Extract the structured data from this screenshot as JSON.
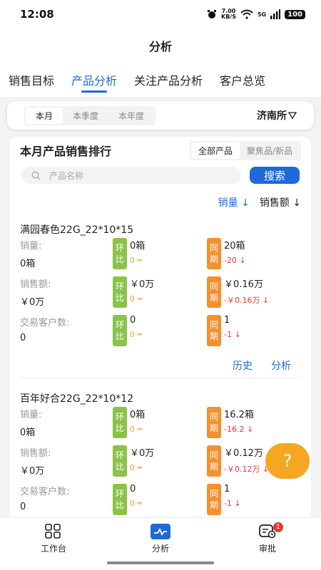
{
  "status": {
    "time": "12:08",
    "speed_value": "7.00",
    "speed_unit": "KB/S",
    "network": "5G",
    "battery": "100"
  },
  "header": {
    "title": "分析"
  },
  "tabs": [
    {
      "label": "销售目标"
    },
    {
      "label": "产品分析"
    },
    {
      "label": "关注产品分析"
    },
    {
      "label": "客户总览"
    }
  ],
  "period": {
    "options": [
      "本月",
      "本季度",
      "本年度"
    ],
    "store": "济南所"
  },
  "ranking": {
    "title": "本月产品销售排行",
    "filters": [
      "全部产品",
      "聚焦品/新品"
    ],
    "search_placeholder": "产品名称",
    "search_button": "搜索",
    "sort_qty": "销量",
    "sort_amt": "销售额"
  },
  "labels": {
    "qty": "销量:",
    "amount": "销售额:",
    "customers": "交易客户数:",
    "hb_1": "环",
    "hb_2": "比",
    "tq_1": "同",
    "tq_2": "期",
    "history": "历史",
    "analysis": "分析"
  },
  "products": [
    {
      "name": "满园春色22G_22*10*15",
      "qty": {
        "value": "0箱",
        "hb_value": "0箱",
        "hb_delta": "0",
        "tq_value": "20箱",
        "tq_delta": "-20"
      },
      "amount": {
        "value": "￥0万",
        "hb_value": "￥0万",
        "hb_delta": "0",
        "tq_value": "￥0.16万",
        "tq_delta": "-￥0.16万"
      },
      "customers": {
        "value": "0",
        "hb_value": "0",
        "hb_delta": "0",
        "tq_value": "1",
        "tq_delta": "-1"
      }
    },
    {
      "name": "百年好合22G_22*10*12",
      "qty": {
        "value": "0箱",
        "hb_value": "0箱",
        "hb_delta": "0",
        "tq_value": "16.2箱",
        "tq_delta": "-16.2"
      },
      "amount": {
        "value": "￥0万",
        "hb_value": "￥0万",
        "hb_delta": "0",
        "tq_value": "￥0.12万",
        "tq_delta": "-￥0.12万"
      },
      "customers": {
        "value": "0",
        "hb_value": "0",
        "hb_delta": "0",
        "tq_value": "1",
        "tq_delta": "-1"
      }
    }
  ],
  "fab": {
    "label": "?"
  },
  "bottom_nav": [
    {
      "label": "工作台",
      "icon": "grid-icon"
    },
    {
      "label": "分析",
      "icon": "chart-icon"
    },
    {
      "label": "审批",
      "icon": "approval-icon",
      "badge": "1"
    }
  ],
  "colors": {
    "accent": "#1f6ad8",
    "hb_tag": "#8bc34a",
    "tq_tag": "#f5902e",
    "decline": "#e53935",
    "fab": "#f5a623"
  }
}
